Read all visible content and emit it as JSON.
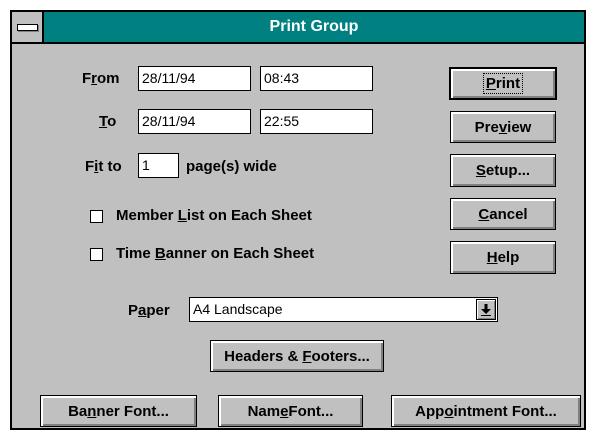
{
  "window": {
    "title": "Print Group"
  },
  "from": {
    "label_pre": "F",
    "label_ul": "r",
    "label_post": "om",
    "date": "28/11/94",
    "time": "08:43"
  },
  "to": {
    "label_pre": "",
    "label_ul": "T",
    "label_post": "o",
    "date": "28/11/94",
    "time": "22:55"
  },
  "fit": {
    "label_pre": "F",
    "label_ul": "i",
    "label_post": "t to",
    "value": "1",
    "suffix": "page(s) wide"
  },
  "checkboxes": {
    "member_list": {
      "pre": "Member ",
      "ul": "L",
      "post": "ist on Each Sheet",
      "checked": false
    },
    "time_banner": {
      "pre": "Time ",
      "ul": "B",
      "post": "anner on Each Sheet",
      "checked": false
    }
  },
  "paper": {
    "label_pre": "P",
    "label_ul": "a",
    "label_post": "per",
    "value": "A4 Landscape"
  },
  "buttons": {
    "print": {
      "ul": "P",
      "post": "rint"
    },
    "preview": {
      "pre": "Pre",
      "ul": "v",
      "post": "iew"
    },
    "setup": {
      "ul": "S",
      "post": "etup..."
    },
    "cancel": {
      "ul": "C",
      "post": "ancel"
    },
    "help": {
      "ul": "H",
      "post": "elp"
    },
    "headers": {
      "pre": "Headers & ",
      "ul": "F",
      "post": "ooters..."
    },
    "banner_font": {
      "pre": "Ba",
      "ul": "n",
      "post": "ner Font..."
    },
    "name_font": {
      "pre": "Nam",
      "ul": "e",
      "post": " Font..."
    },
    "appointment_font": {
      "pre": "App",
      "ul": "o",
      "post": "intment Font..."
    }
  }
}
